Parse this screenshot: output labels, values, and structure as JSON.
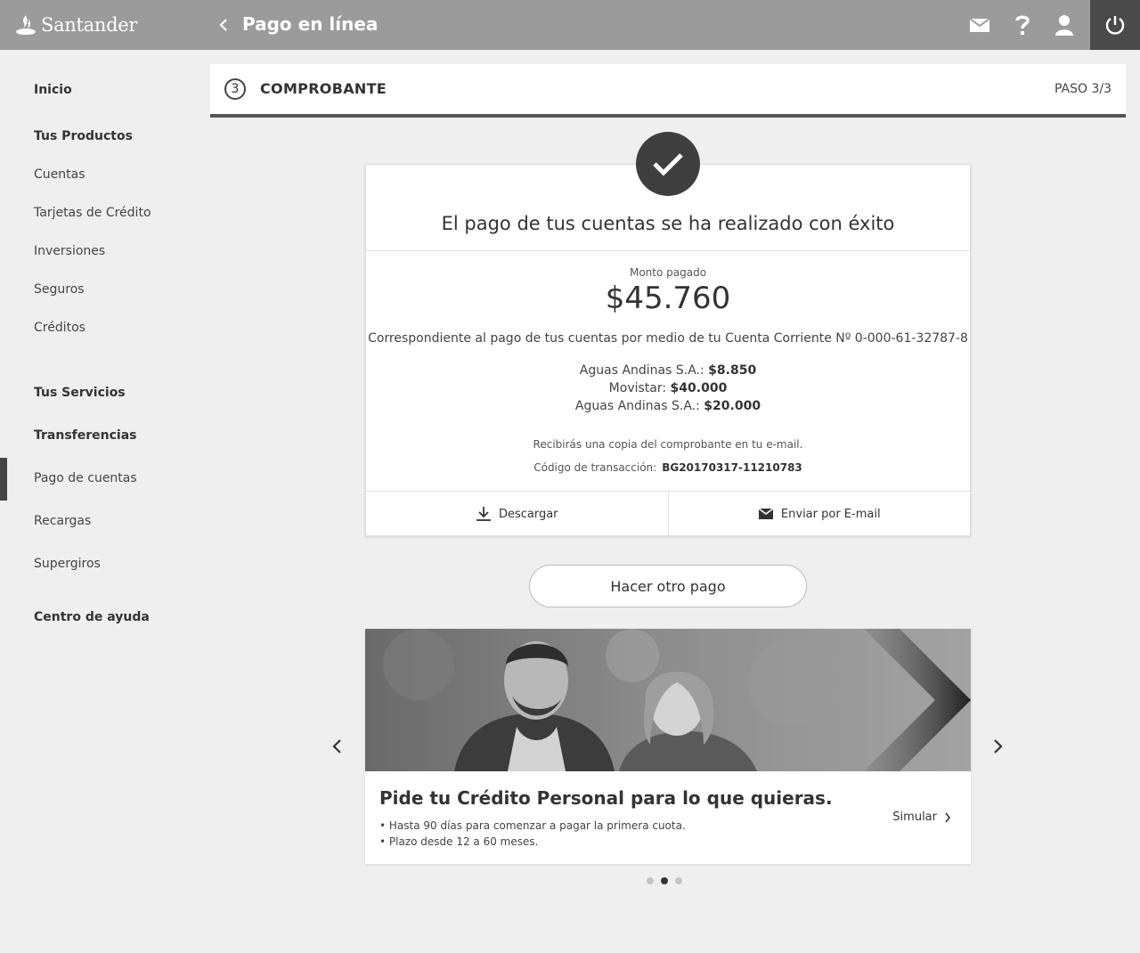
{
  "header": {
    "brand": "Santander",
    "title": "Pago en línea",
    "background": "#9b9b9b"
  },
  "sidebar": {
    "items": [
      {
        "label": "Inicio"
      },
      {
        "label": "Tus Productos"
      },
      {
        "label": "Cuentas"
      },
      {
        "label": "Tarjetas de Crédito"
      },
      {
        "label": "Inversiones"
      },
      {
        "label": "Seguros"
      },
      {
        "label": "Créditos"
      },
      {
        "label": "Tus Servicios"
      },
      {
        "label": "Transferencias"
      },
      {
        "label": "Pago de cuentas"
      },
      {
        "label": "Recargas"
      },
      {
        "label": "Supergiros"
      },
      {
        "label": "Centro de ayuda"
      }
    ],
    "active": "Pago de cuentas"
  },
  "step": {
    "number": "3",
    "title": "COMPROBANTE",
    "count": "PASO 3/3"
  },
  "receipt": {
    "title": "El pago de tus cuentas se ha realizado con éxito",
    "amount_label": "Monto pagado",
    "amount": "$45.760",
    "description": "Correspondiente al pago de tus cuentas por medio de tu Cuenta Corriente Nº 0-000-61-32787-8",
    "payments": [
      {
        "name": "Aguas Andinas S.A.:",
        "amount": "$8.850"
      },
      {
        "name": "Movistar:",
        "amount": "$40.000"
      },
      {
        "name": "Aguas Andinas S.A.:",
        "amount": "$20.000"
      }
    ],
    "copy_note": "Recibirás una copia del comprobante en tu e-mail.",
    "tx_label": "Código de transacción:",
    "tx_code": "BG20170317-11210783",
    "download_label": "Descargar",
    "email_label": "Enviar por E-mail"
  },
  "other_payment_label": "Hacer otro pago",
  "promo": {
    "title": "Pide tu Crédito Personal para lo que quieras.",
    "bullet1": "• Hasta 90 días para comenzar a pagar la primera cuota.",
    "bullet2": "• Plazo desde 12 a 60 meses.",
    "cta": "Simular"
  },
  "carousel": {
    "active_dot": 2,
    "dots": 3
  }
}
